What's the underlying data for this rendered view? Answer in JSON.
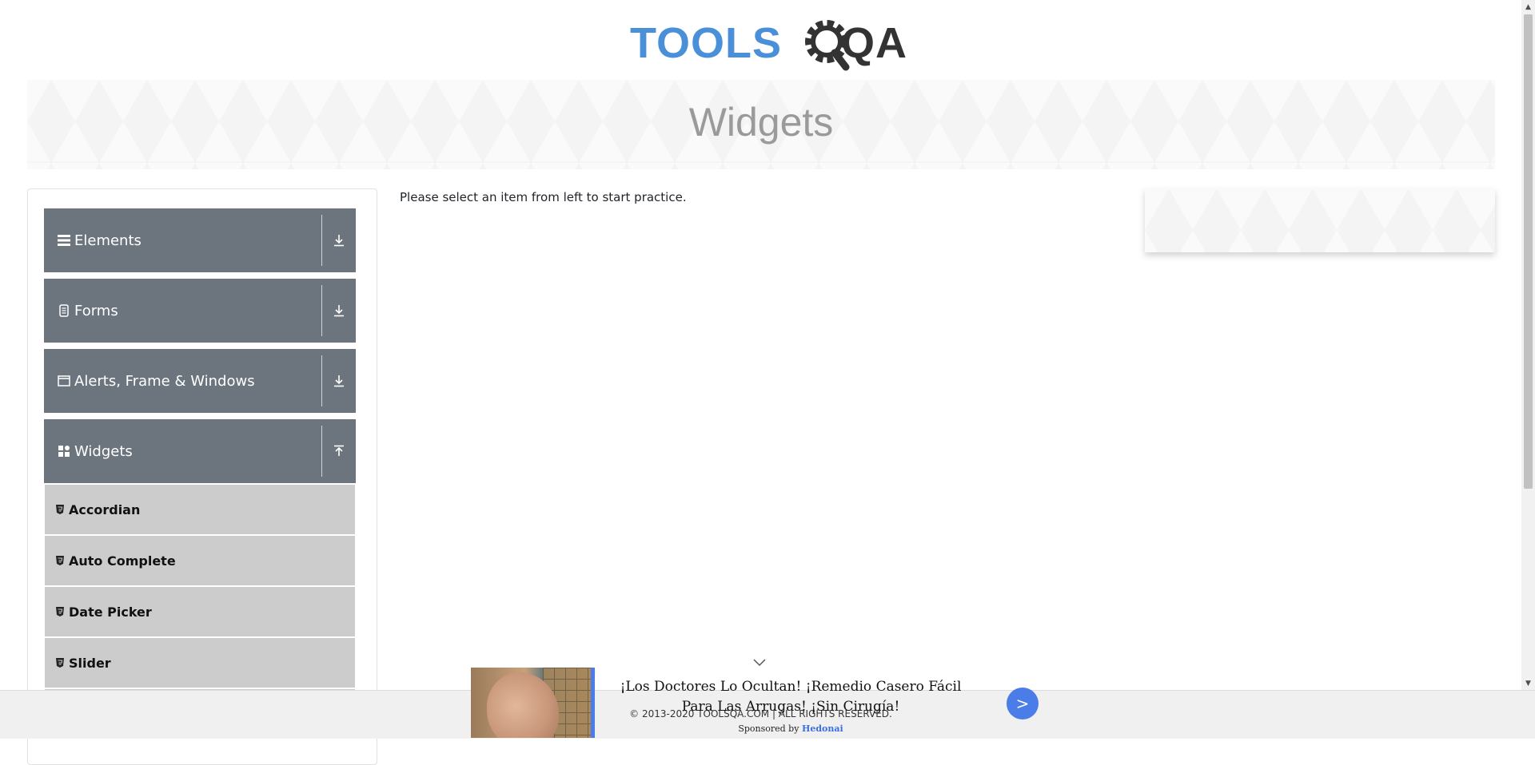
{
  "header": {
    "logo_text_tools": "TOOLS",
    "logo_text_qa": "QA"
  },
  "banner": {
    "title": "Widgets"
  },
  "sidebar": {
    "groups": [
      {
        "label": "Elements",
        "icon": "menu-icon",
        "state": "collapsed"
      },
      {
        "label": "Forms",
        "icon": "file-icon",
        "state": "collapsed"
      },
      {
        "label": "Alerts, Frame & Windows",
        "icon": "window-icon",
        "state": "collapsed"
      },
      {
        "label": "Widgets",
        "icon": "grid-icon",
        "state": "expanded"
      }
    ],
    "widget_items": [
      {
        "label": "Accordian"
      },
      {
        "label": "Auto Complete"
      },
      {
        "label": "Date Picker"
      },
      {
        "label": "Slider"
      }
    ]
  },
  "main": {
    "message": "Please select an item from left to start practice."
  },
  "footer": {
    "copyright": "© 2013-2020 TOOLSQA.COM | ALL RIGHTS RESERVED."
  },
  "ad": {
    "headline": "¡Los Doctores Lo Ocultan! ¡Remedio Casero Fácil Para Las Arrugas! ¡Sin Cirugía!",
    "sponsored_prefix": "Sponsored by",
    "sponsor": "Hedonai",
    "button_label": ">"
  },
  "colors": {
    "group_bg": "#6c757d",
    "subitem_bg": "#cccccc",
    "logo_blue": "#4a90d9",
    "ad_accent": "#4a7de8"
  }
}
